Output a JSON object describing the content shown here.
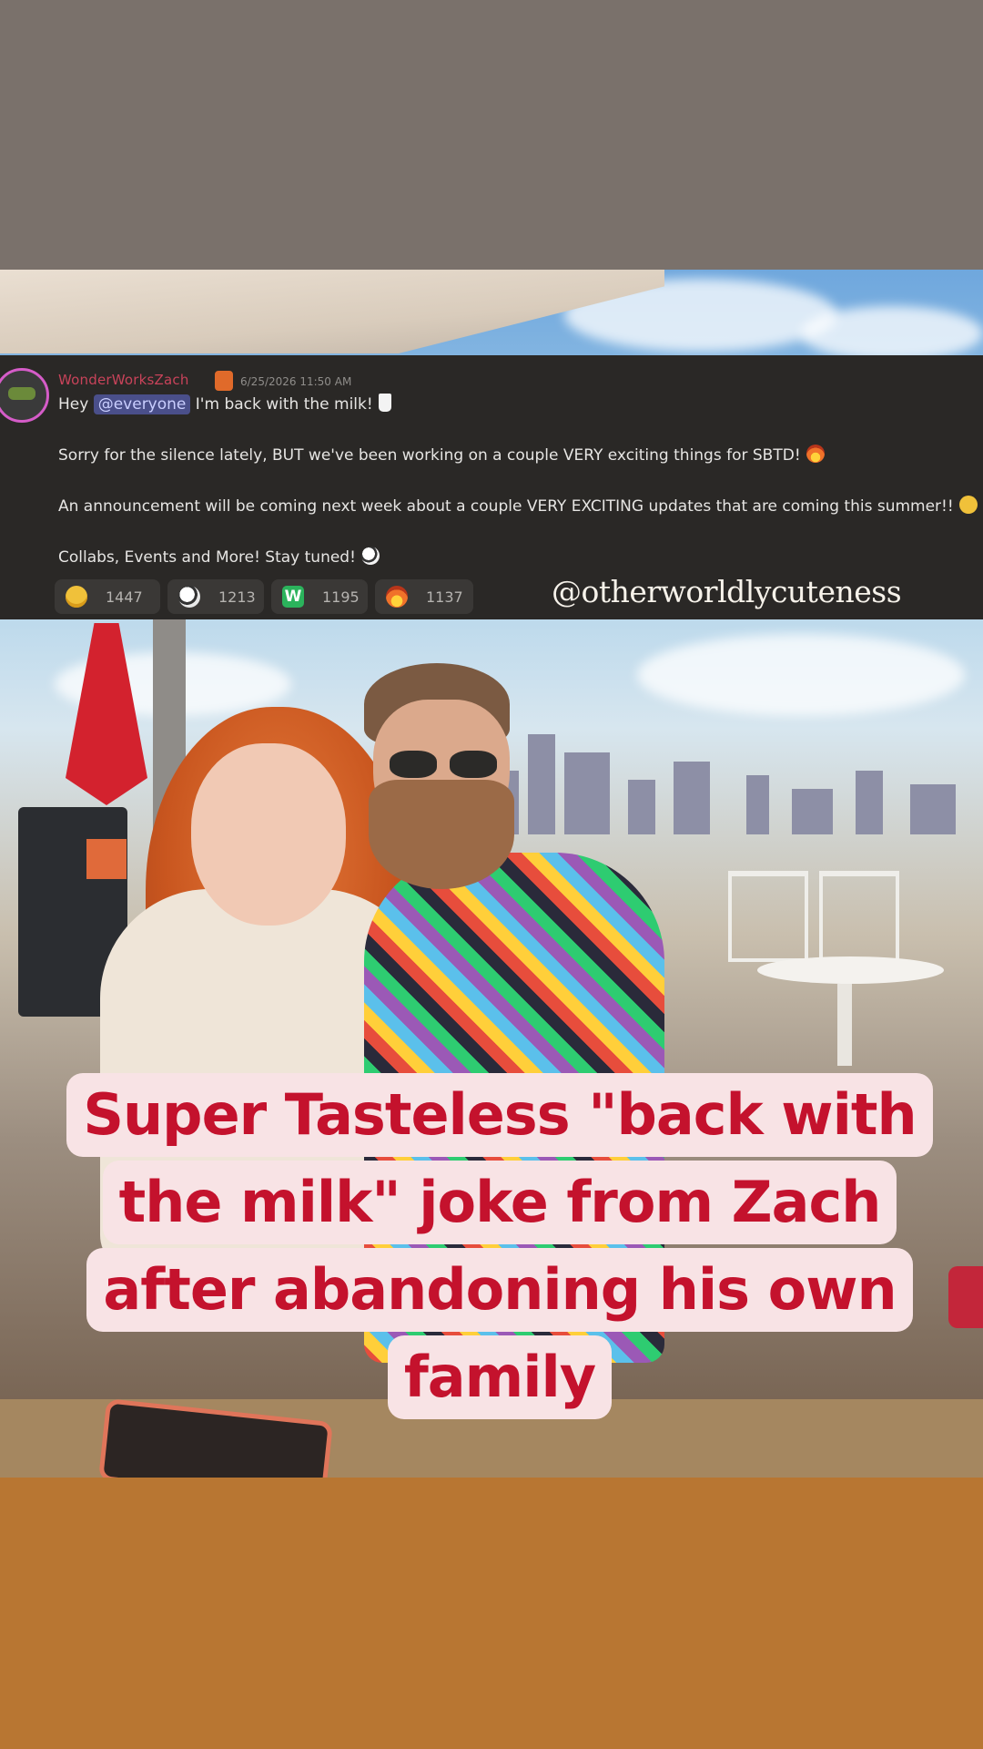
{
  "discord": {
    "username": "WonderWorksZach",
    "timestamp": "6/25/2026 11:50 AM",
    "line1_pre": "Hey ",
    "mention": "@everyone",
    "line1_post": " I'm back with the milk!",
    "line2": "Sorry for the silence lately, BUT we've been working on a couple VERY exciting things for SBTD!",
    "line3": "An announcement will be coming next week about a couple VERY EXCITING updates that are coming this summer!!",
    "line4": "Collabs, Events and More! Stay tuned!",
    "reactions": [
      {
        "icon": "heart-eyes-emoji-icon",
        "count": "1447"
      },
      {
        "icon": "cow-emoji-icon",
        "count": "1213"
      },
      {
        "icon": "w-emoji-icon",
        "label": "W",
        "count": "1195"
      },
      {
        "icon": "fire-emoji-icon",
        "count": "1137"
      }
    ]
  },
  "watermark": "@otherworldlycuteness",
  "caption": {
    "lines": [
      "Super Tasteless \"back with",
      "the milk\" joke from Zach",
      "after abandoning his own",
      "family"
    ]
  },
  "colors": {
    "top_band": "#7a716b",
    "bottom_band": "#b87632",
    "caption_text": "#c4122d",
    "caption_bg": "#f8e3e5",
    "discord_bg": "#2a2826"
  }
}
